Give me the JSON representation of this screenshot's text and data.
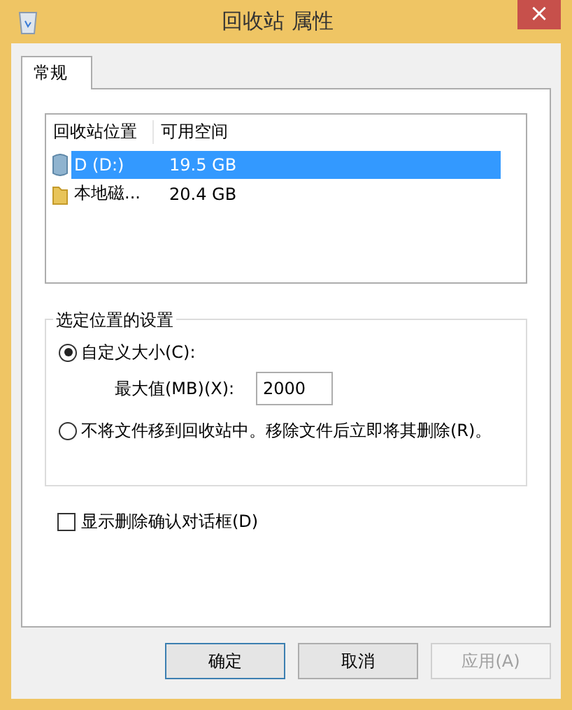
{
  "window": {
    "title": "回收站 属性",
    "close": "×"
  },
  "tabs": [
    {
      "label": "常规",
      "selected": true
    }
  ],
  "list": {
    "columns": [
      "回收站位置",
      "可用空间"
    ],
    "rows": [
      {
        "kind": "drive",
        "name": "D (D:)",
        "free": "19.5 GB",
        "selected": true
      },
      {
        "kind": "folder",
        "name": "本地磁...",
        "free": "20.4 GB",
        "selected": false
      }
    ]
  },
  "settings": {
    "title": "选定位置的设置",
    "options": [
      {
        "label": "自定义大小(C):",
        "selected": true
      },
      {
        "label": "不将文件移到回收站中。移除文件后立即将其删除(R)。",
        "selected": false
      }
    ],
    "max_label": "最大值(MB)(X):",
    "max_value": "2000"
  },
  "confirm": {
    "label": "显示删除确认对话框(D)",
    "checked": false
  },
  "buttons": [
    {
      "label": "确定",
      "disabled": false,
      "default": true
    },
    {
      "label": "取消",
      "disabled": false,
      "default": false
    },
    {
      "label": "应用(A)",
      "disabled": true,
      "default": false
    }
  ]
}
